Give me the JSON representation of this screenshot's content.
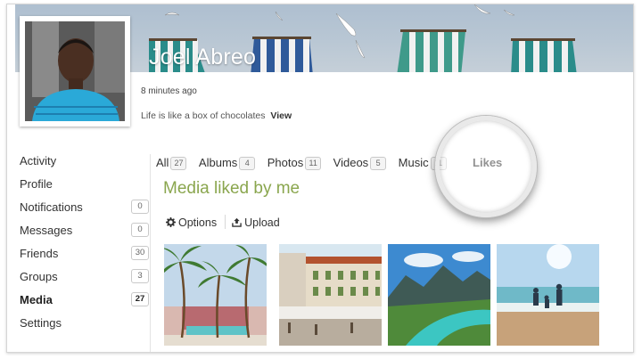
{
  "profile": {
    "name": "Joel Abreo",
    "last_active": "8 minutes ago",
    "status_text": "Life is like a box of chocolates",
    "status_link": "View"
  },
  "sidebar": {
    "items": [
      {
        "label": "Activity",
        "count": null,
        "active": false
      },
      {
        "label": "Profile",
        "count": null,
        "active": false
      },
      {
        "label": "Notifications",
        "count": "0",
        "active": false
      },
      {
        "label": "Messages",
        "count": "0",
        "active": false
      },
      {
        "label": "Friends",
        "count": "30",
        "active": false
      },
      {
        "label": "Groups",
        "count": "3",
        "active": false
      },
      {
        "label": "Media",
        "count": "27",
        "active": true
      },
      {
        "label": "Settings",
        "count": null,
        "active": false
      }
    ]
  },
  "tabs": [
    {
      "label": "All",
      "count": "27"
    },
    {
      "label": "Albums",
      "count": "4"
    },
    {
      "label": "Photos",
      "count": "11"
    },
    {
      "label": "Videos",
      "count": "5"
    },
    {
      "label": "Music",
      "count": "11"
    },
    {
      "label": "Likes",
      "count": null,
      "active": true
    }
  ],
  "media_heading": "Media liked by me",
  "actions": {
    "options_label": "Options",
    "upload_label": "Upload"
  },
  "thumbnails": [
    {
      "name": "palm-trees-resort-photo"
    },
    {
      "name": "street-buildings-photo"
    },
    {
      "name": "mountain-river-photo"
    },
    {
      "name": "family-beach-photo"
    }
  ],
  "colors": {
    "heading_accent": "#8aa64e",
    "border": "#d6d6d6"
  }
}
